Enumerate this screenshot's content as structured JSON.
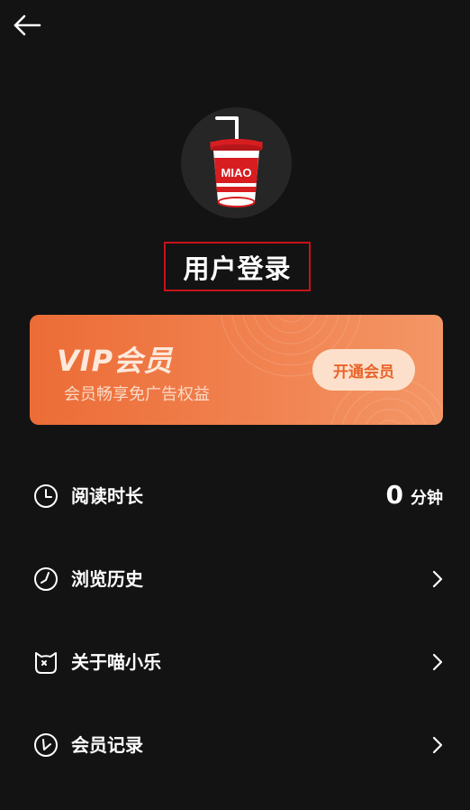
{
  "header": {
    "back_icon": "arrow-left-icon"
  },
  "profile": {
    "avatar_logo_text": "MIAO",
    "login_label": "用户登录",
    "login_border_color": "#c8121a"
  },
  "vip": {
    "title": "VIP会员",
    "subtitle": "会员畅享免广告权益",
    "button_label": "开通会员",
    "accent_color": "#ec6c36"
  },
  "menu": {
    "reading_time": {
      "label": "阅读时长",
      "value": "0",
      "unit": "分钟",
      "icon": "clock-icon"
    },
    "history": {
      "label": "浏览历史",
      "icon": "history-clock-icon"
    },
    "about": {
      "label": "关于喵小乐",
      "icon": "cat-face-icon"
    },
    "membership_records": {
      "label": "会员记录",
      "icon": "record-clock-icon"
    }
  }
}
